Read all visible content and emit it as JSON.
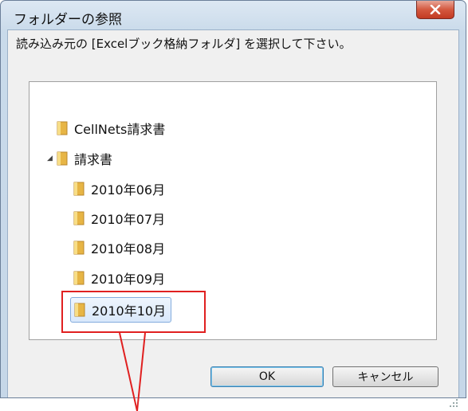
{
  "dialog": {
    "title": "フォルダーの参照",
    "instruction": "読み込み元の [Excelブック格納フォルダ] を選択して下さい。",
    "ok_label": "OK",
    "cancel_label": "キャンセル"
  },
  "tree": {
    "items": [
      {
        "label": "CellNets請求書",
        "icon": "folder-icon"
      },
      {
        "label": "請求書",
        "icon": "folder-icon",
        "expanded": true
      },
      {
        "label": "2010年06月",
        "icon": "folder-icon"
      },
      {
        "label": "2010年07月",
        "icon": "folder-icon"
      },
      {
        "label": "2010年08月",
        "icon": "folder-icon"
      },
      {
        "label": "2010年09月",
        "icon": "folder-icon"
      },
      {
        "label": "2010年10月",
        "icon": "folder-icon",
        "selected": true
      }
    ]
  },
  "colors": {
    "highlight": "#e02020",
    "selection_border": "#84acdd",
    "close_button": "#c23a22"
  }
}
